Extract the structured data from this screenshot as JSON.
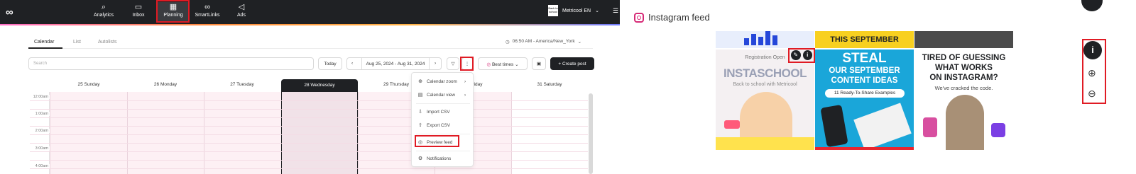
{
  "nav": {
    "items": [
      {
        "label": "Analytics",
        "icon": "analytics-icon"
      },
      {
        "label": "Inbox",
        "icon": "inbox-icon"
      },
      {
        "label": "Planning",
        "icon": "calendar-icon"
      },
      {
        "label": "SmartLinks",
        "icon": "link-icon"
      },
      {
        "label": "Ads",
        "icon": "megaphone-icon"
      }
    ],
    "active": "Planning",
    "account_name": "Metricool EN",
    "account_avatar_text": "Back to school"
  },
  "tabs": [
    "Calendar",
    "List",
    "Autolists"
  ],
  "timezone": "06:50 AM - America/New_York",
  "toolbar": {
    "search_placeholder": "Search",
    "today_label": "Today",
    "date_range": "Aug 25, 2024 - Aug 31, 2024",
    "best_times_label": "Best times",
    "create_post_label": "Create post"
  },
  "calendar": {
    "days": [
      "25 Sunday",
      "26 Monday",
      "27 Tuesday",
      "28 Wednesday",
      "29 Thursday",
      "30 Friday",
      "31 Saturday"
    ],
    "active_day": "28 Wednesday",
    "hours": [
      "12:00am",
      "1:00am",
      "2:00am",
      "3:00am",
      "4:00am"
    ]
  },
  "menu": {
    "items": [
      {
        "label": "Calendar zoom",
        "icon": "zoom-icon",
        "submenu": true
      },
      {
        "label": "Calendar view",
        "icon": "calendar-view-icon",
        "submenu": true
      },
      {
        "label": "Import CSV",
        "icon": "import-icon",
        "submenu": false
      },
      {
        "label": "Export CSV",
        "icon": "export-icon",
        "submenu": false
      },
      {
        "label": "Preview feed",
        "icon": "instagram-icon",
        "submenu": false
      },
      {
        "label": "Notifications",
        "icon": "gear-icon",
        "submenu": false
      }
    ],
    "highlighted": "Preview feed"
  },
  "panel": {
    "title": "Instagram feed",
    "posts": {
      "top_middle": "THIS SEPTEMBER",
      "left_line1": "Registration Open",
      "left_brand": "INSTASCHOOL",
      "left_sub": "Back to school with Metricool",
      "middle_line1": "STEAL",
      "middle_line2": "OUR SEPTEMBER",
      "middle_line3": "CONTENT IDEAS",
      "middle_pill": "11 Ready-To-Share Examples",
      "right_line1": "TIRED OF GUESSING",
      "right_line2": "WHAT WORKS",
      "right_line3": "ON INSTAGRAM?",
      "right_sub": "We've cracked the code."
    },
    "side_icons": [
      "info-icon",
      "zoom-in-icon",
      "zoom-out-icon"
    ]
  },
  "colors": {
    "topbar": "#1f2124",
    "highlight": "#e01b24",
    "calendar_pink": "#fdf0f4",
    "post_blue": "#1aa6d9",
    "post_yellow": "#f8d020"
  }
}
